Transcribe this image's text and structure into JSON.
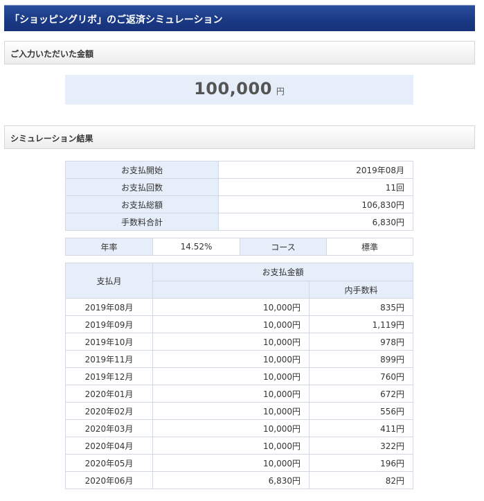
{
  "title": "「ショッピングリボ」のご返済シミュレーション",
  "input_section": {
    "header": "ご入力いただいた金額",
    "amount": "100,000",
    "unit": "円"
  },
  "result_section": {
    "header": "シミュレーション結果"
  },
  "summary": [
    {
      "label": "お支払開始",
      "value": "2019年08月"
    },
    {
      "label": "お支払回数",
      "value": "11回"
    },
    {
      "label": "お支払総額",
      "value": "106,830円"
    },
    {
      "label": "手数料合計",
      "value": "6,830円"
    }
  ],
  "rate_row": {
    "rate_label": "年率",
    "rate_value": "14.52%",
    "course_label": "コース",
    "course_value": "標準"
  },
  "schedule": {
    "headers": {
      "month": "支払月",
      "amount": "お支払金額",
      "fee": "内手数料"
    },
    "rows": [
      {
        "month": "2019年08月",
        "amount": "10,000円",
        "fee": "835円"
      },
      {
        "month": "2019年09月",
        "amount": "10,000円",
        "fee": "1,119円"
      },
      {
        "month": "2019年10月",
        "amount": "10,000円",
        "fee": "978円"
      },
      {
        "month": "2019年11月",
        "amount": "10,000円",
        "fee": "899円"
      },
      {
        "month": "2019年12月",
        "amount": "10,000円",
        "fee": "760円"
      },
      {
        "month": "2020年01月",
        "amount": "10,000円",
        "fee": "672円"
      },
      {
        "month": "2020年02月",
        "amount": "10,000円",
        "fee": "556円"
      },
      {
        "month": "2020年03月",
        "amount": "10,000円",
        "fee": "411円"
      },
      {
        "month": "2020年04月",
        "amount": "10,000円",
        "fee": "322円"
      },
      {
        "month": "2020年05月",
        "amount": "10,000円",
        "fee": "196円"
      },
      {
        "month": "2020年06月",
        "amount": "6,830円",
        "fee": "82円"
      }
    ]
  },
  "colors": {
    "title_bar": "#1b3a85",
    "label_bg": "#e6eefa",
    "border": "#d2d8e2"
  }
}
